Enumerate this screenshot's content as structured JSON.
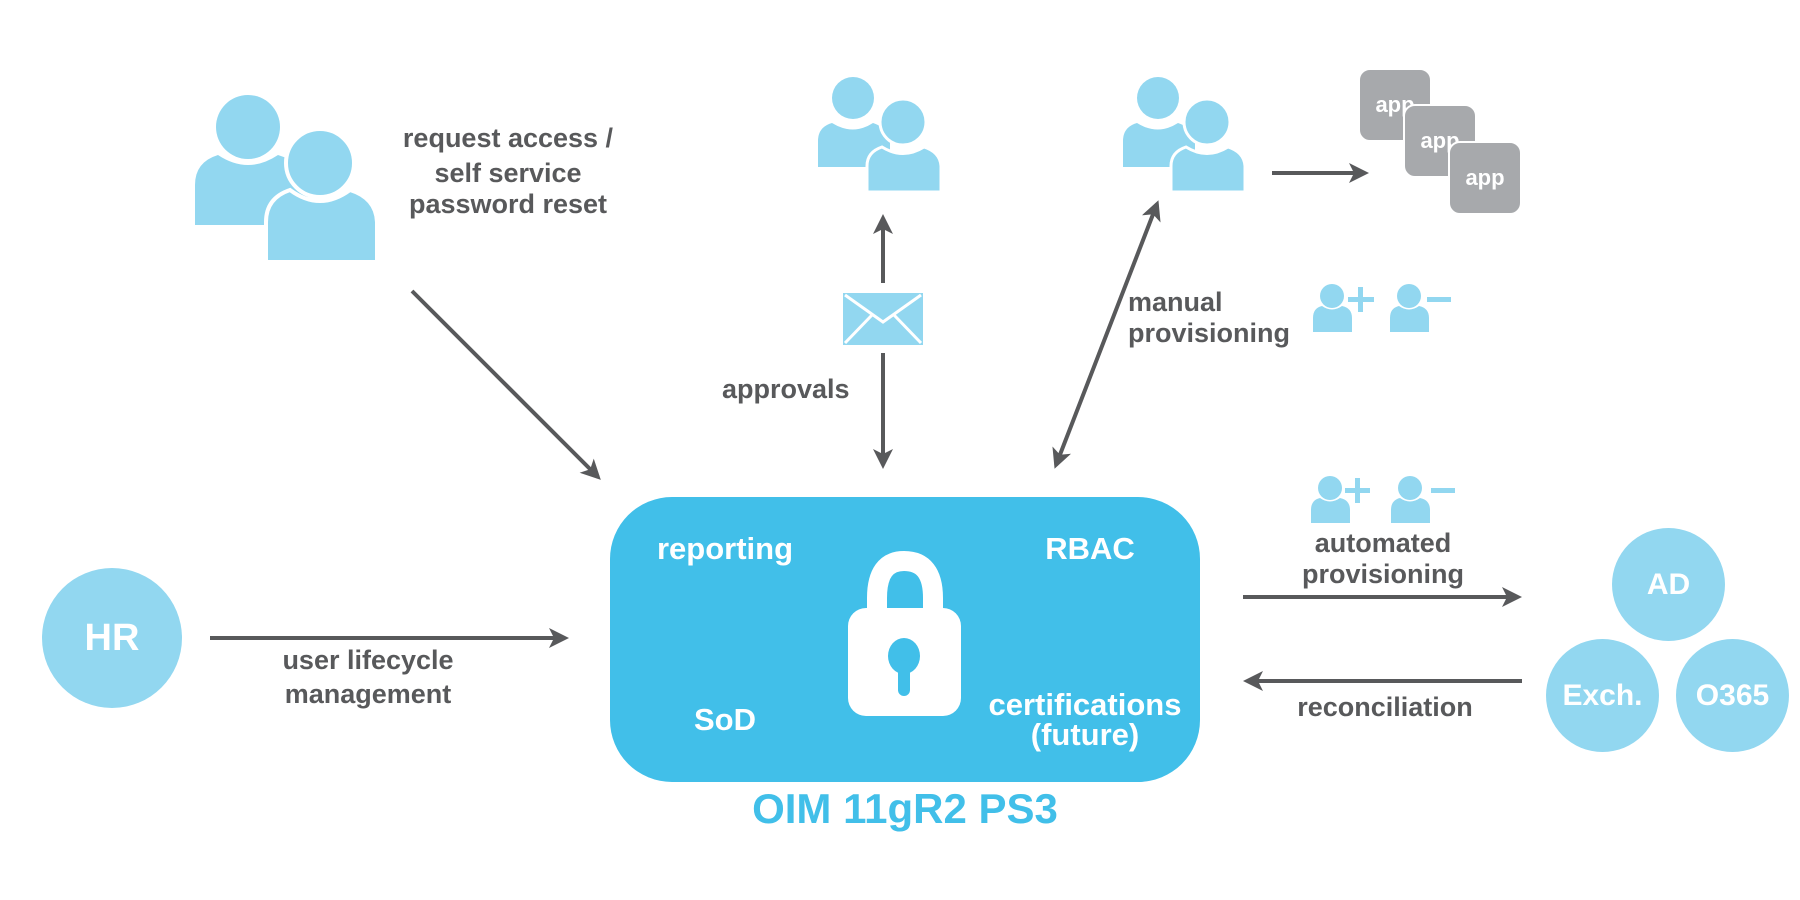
{
  "colors": {
    "accent_blue": "#41bfe9",
    "light_blue": "#92d7f0",
    "arrow_gray": "#58595b",
    "app_gray": "#a7a9ac"
  },
  "nodes": {
    "requesters": {
      "icon": "users-icon",
      "label_lines": [
        "request access /",
        "self service",
        "password reset"
      ]
    },
    "approvers": {
      "icon": "users-icon",
      "message_icon": "envelope-icon",
      "label": "approvals"
    },
    "provisioners": {
      "icon": "users-icon",
      "label_lines": [
        "manual",
        "provisioning"
      ]
    },
    "apps": [
      "app",
      "app",
      "app"
    ],
    "hr": {
      "label": "HR",
      "flow_label_lines": [
        "user lifecycle",
        "management"
      ]
    },
    "core": {
      "title": "OIM 11gR2 PS3",
      "icon": "lock-icon",
      "features": [
        "reporting",
        "RBAC",
        "SoD",
        "certifications",
        "(future)"
      ]
    },
    "automated": {
      "label_lines": [
        "automated",
        "provisioning"
      ],
      "reverse_label": "reconciliation"
    },
    "targets": [
      "AD",
      "Exch.",
      "O365"
    ],
    "user_ops": {
      "add_icon": "user-add-icon",
      "remove_icon": "user-remove-icon"
    }
  }
}
